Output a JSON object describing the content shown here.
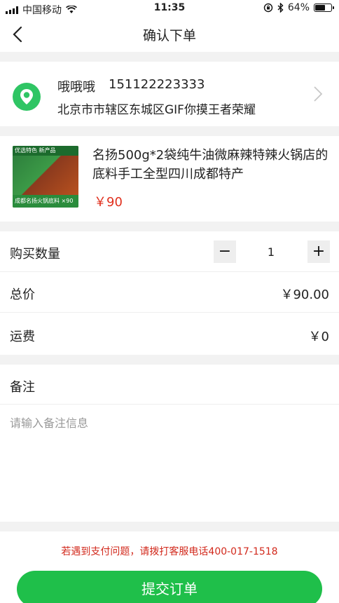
{
  "status_bar": {
    "carrier": "中国移动",
    "time": "11:35",
    "battery_label": "64%",
    "battery_level": 0.64
  },
  "nav": {
    "title": "确认下单"
  },
  "address": {
    "name": "哦哦哦",
    "phone": "151122223333",
    "detail": "北京市市辖区东城区GIF你摸王者荣耀"
  },
  "product": {
    "name": "名扬500g*2袋纯牛油微麻辣特辣火锅店的底料手工全型四川成都特产",
    "price": "￥90",
    "thumb_top_text": "优选特色 新产品",
    "thumb_bottom_text": "成都名扬火锅底料 ×90"
  },
  "order": {
    "quantity_label": "购买数量",
    "quantity": "1",
    "total_label": "总价",
    "total_value": "￥90.00",
    "shipping_label": "运费",
    "shipping_value": "￥0"
  },
  "remark": {
    "label": "备注",
    "placeholder": "请输入备注信息"
  },
  "footer": {
    "notice": "若遇到支付问题，请拨打客服电话400-017-1518",
    "submit_label": "提交订单"
  },
  "colors": {
    "accent_green": "#1fbf4a",
    "price_red": "#e0301e",
    "notice_red": "#d2291c"
  },
  "icons": [
    "signal-icon",
    "wifi-icon",
    "orientation-lock-icon",
    "bluetooth-icon",
    "battery-icon",
    "back-arrow-icon",
    "location-pin-icon",
    "chevron-right-icon",
    "minus-icon",
    "plus-icon"
  ]
}
